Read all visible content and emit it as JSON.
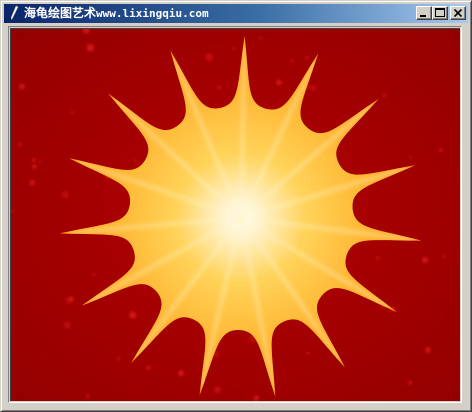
{
  "window": {
    "title_prefix": "海龟绘图艺术",
    "title_url": "www.lixingqiu.com",
    "icon": "feather-pen-icon"
  },
  "titlebar_buttons": [
    {
      "name": "minimize-button",
      "icon": "minimize-icon"
    },
    {
      "name": "maximize-button",
      "icon": "maximize-icon"
    },
    {
      "name": "close-button",
      "icon": "close-icon"
    }
  ],
  "drawing": {
    "description_icon": "sunburst-star-icon",
    "background_color": "#a00000",
    "star_points": 15,
    "center_color": "#ffffff",
    "mid_color": "#ffd35a",
    "edge_color": "#ffa41a"
  }
}
